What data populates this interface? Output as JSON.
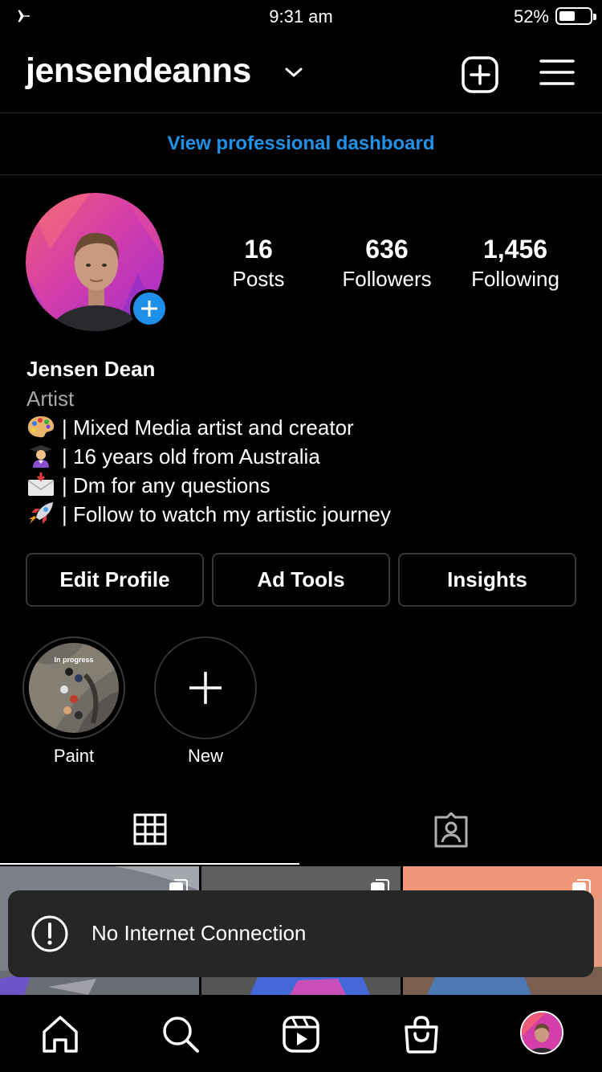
{
  "status_bar": {
    "time": "9:31 am",
    "battery_percent": "52%",
    "battery_level": 0.52
  },
  "header": {
    "username": "jensendeanns"
  },
  "dashboard_link": "View professional dashboard",
  "stats": [
    {
      "value": "16",
      "label": "Posts"
    },
    {
      "value": "636",
      "label": "Followers"
    },
    {
      "value": "1,456",
      "label": "Following"
    }
  ],
  "bio": {
    "name": "Jensen Dean",
    "category": "Artist",
    "lines": [
      {
        "emoji": "palette",
        "text": "| Mixed Media artist and creator"
      },
      {
        "emoji": "student",
        "text": "| 16 years old from Australia"
      },
      {
        "emoji": "envelope",
        "text": "| Dm for any questions"
      },
      {
        "emoji": "rocket",
        "text": "| Follow to watch my artistic journey"
      }
    ]
  },
  "buttons": {
    "edit_profile": "Edit Profile",
    "ad_tools": "Ad Tools",
    "insights": "Insights"
  },
  "highlights": [
    {
      "label": "Paint",
      "cover_text": "In progress"
    },
    {
      "label": "New"
    }
  ],
  "toast": {
    "message": "No Internet Connection"
  },
  "colors": {
    "accent": "#1e92e8",
    "background": "#000000",
    "toast_bg": "#262626"
  }
}
